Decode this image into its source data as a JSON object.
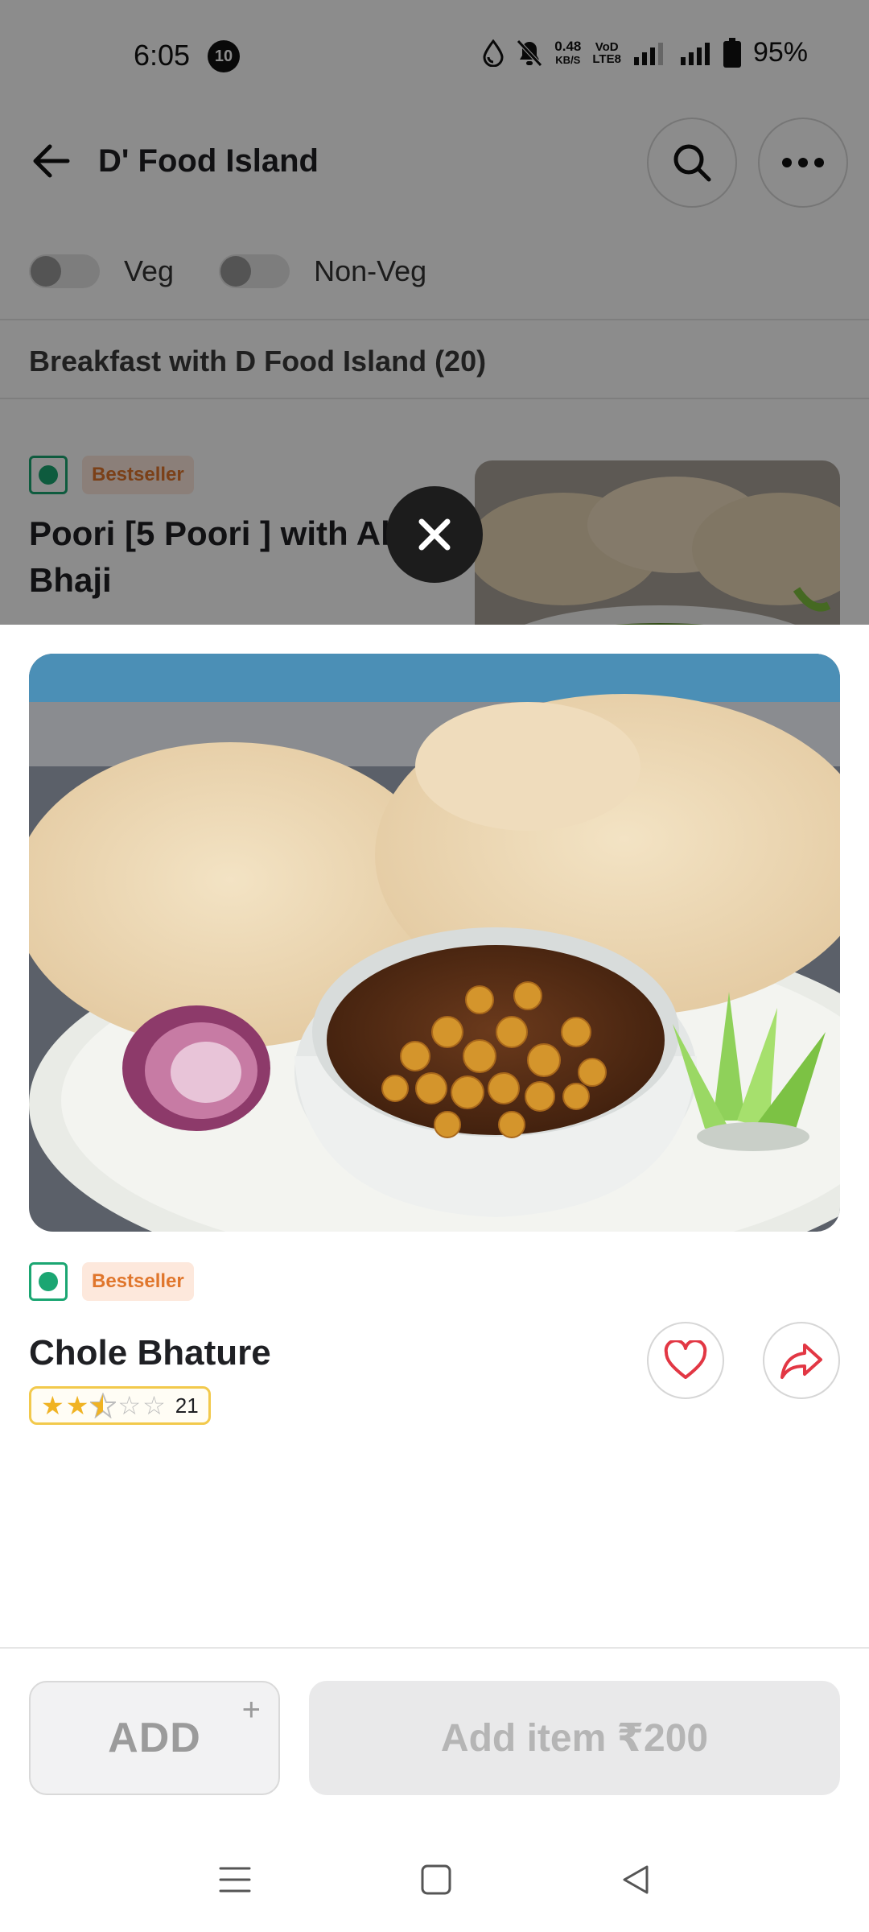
{
  "status_bar": {
    "time": "6:05",
    "notification_count": "10",
    "net_speed": "0.48",
    "net_speed_unit": "KB/S",
    "volte_top": "VoD",
    "volte_bottom": "LTE8",
    "network": "4G",
    "battery": "95%",
    "icons": [
      "water-drop-icon",
      "bell-off-icon",
      "signal-icon",
      "battery-icon"
    ]
  },
  "header": {
    "title": "D' Food Island",
    "icons": [
      "back-arrow-icon",
      "search-icon",
      "more-icon"
    ]
  },
  "filters": [
    {
      "label": "Veg",
      "on": false
    },
    {
      "label": "Non-Veg",
      "on": false
    }
  ],
  "section": {
    "title": "Breakfast with D Food Island (20)"
  },
  "background_item": {
    "badge": "Bestseller",
    "name": "Poori [5 Poori ] with Al Bhaji"
  },
  "item_sheet": {
    "badge": "Bestseller",
    "name": "Chole Bhature",
    "rating_stars": 2.5,
    "rating_max": 5,
    "rating_count": "21",
    "add_label": "ADD",
    "add_plus": "+",
    "add_to_cart_label": "Add item ₹200",
    "veg_color": "#1ba672",
    "badge_color": "#e0762c"
  },
  "nav_bar": {
    "icons": [
      "menu-icon",
      "home-icon",
      "back-icon"
    ]
  }
}
